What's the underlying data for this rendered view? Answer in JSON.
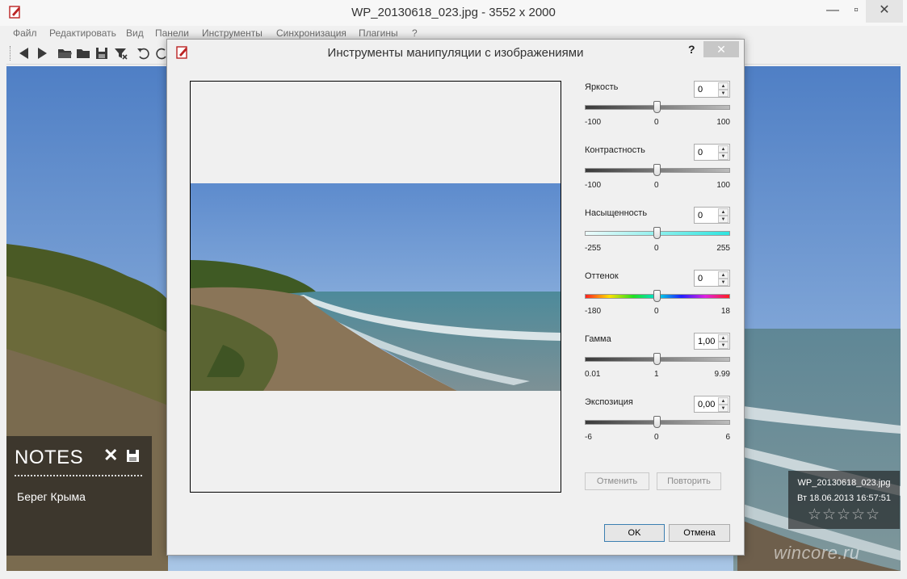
{
  "window": {
    "title": "WP_20130618_023.jpg  - 3552 x 2000"
  },
  "menu": [
    "Файл",
    "Редактировать",
    "Вид",
    "Панели",
    "Инструменты",
    "Синхронизация",
    "Плагины",
    "?"
  ],
  "notes": {
    "title": "NOTES",
    "text": "Берег Крыма"
  },
  "photo_info": {
    "filename": "WP_20130618_023.jpg",
    "datetime": "Вт 18.06.2013 16:57:51",
    "stars": "☆☆☆☆☆"
  },
  "watermark": "wincore.ru",
  "dialog": {
    "title": "Инструменты манипуляции с изображениями",
    "help": "?",
    "close": "✕",
    "controls": [
      {
        "label": "Яркость",
        "value": "0",
        "min": "-100",
        "mid": "0",
        "max": "100"
      },
      {
        "label": "Контрастность",
        "value": "0",
        "min": "-100",
        "mid": "0",
        "max": "100"
      },
      {
        "label": "Насыщенность",
        "value": "0",
        "min": "-255",
        "mid": "0",
        "max": "255"
      },
      {
        "label": "Оттенок",
        "value": "0",
        "min": "-180",
        "mid": "0",
        "max": "18"
      },
      {
        "label": "Гамма",
        "value": "1,00",
        "min": "0.01",
        "mid": "1",
        "max": "9.99"
      },
      {
        "label": "Экспозиция",
        "value": "0,00",
        "min": "-6",
        "mid": "0",
        "max": "6"
      }
    ],
    "undo": "Отменить",
    "redo": "Повторить",
    "ok": "OK",
    "cancel": "Отмена"
  },
  "icons": {
    "app": "app-edit-icon",
    "toolbar": [
      "back-arrow-icon",
      "forward-arrow-icon",
      "open-folder-icon",
      "folder-icon",
      "save-icon",
      "clear-icon",
      "rotate-left-icon",
      "rotate-right-icon"
    ]
  },
  "colors": {
    "title_close_bg": "#e5e5e5",
    "dialog_close_bg": "#c7c7c7",
    "ok_border": "#3c7fb1",
    "notes_bg": "#191919"
  }
}
